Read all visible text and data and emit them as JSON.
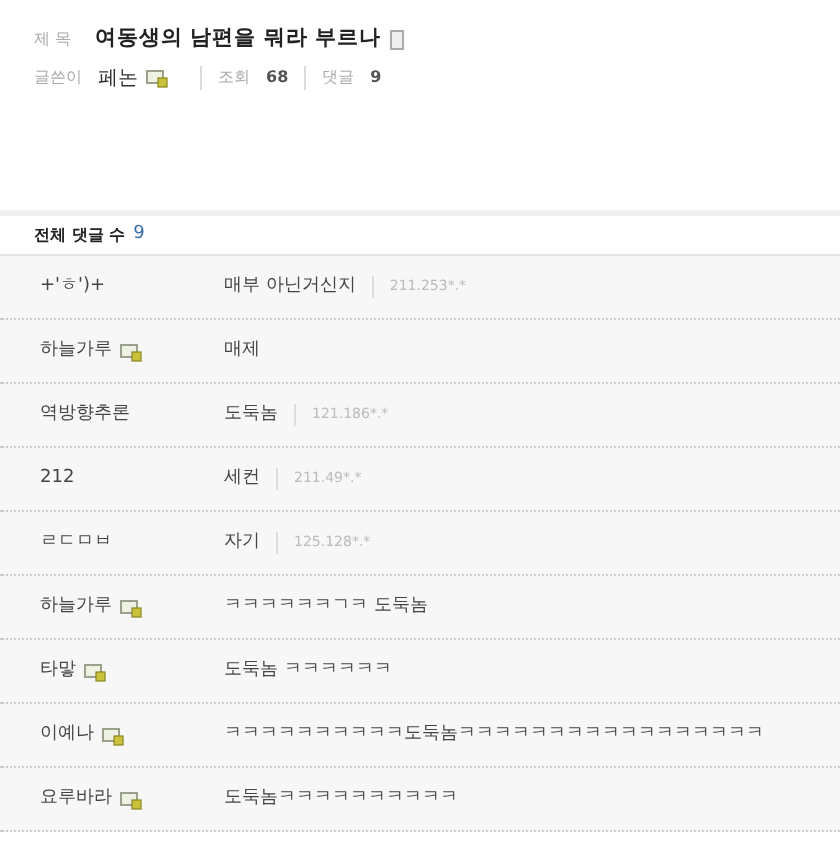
{
  "post": {
    "title_label": "제 목",
    "title": "여동생의 남편을 뭐라 부르나",
    "author_label": "글쓴이",
    "author": "페논",
    "author_member": true,
    "views_label": "조회",
    "views": "68",
    "replies_label": "댓글",
    "replies": "9"
  },
  "comments_header": {
    "label": "전체 댓글 수",
    "count": "9"
  },
  "comments": [
    {
      "author": "+'ㅎ')+",
      "member": false,
      "text": "매부 아닌거신지",
      "ip": "211.253*.*"
    },
    {
      "author": "하늘가루",
      "member": true,
      "text": "매제"
    },
    {
      "author": "역방향추론",
      "member": false,
      "text": "도둑놈",
      "ip": "121.186*.*"
    },
    {
      "author": "212",
      "member": false,
      "text": "세컨",
      "ip": "211.49*.*"
    },
    {
      "author": "ㄹㄷㅁㅂ",
      "member": false,
      "text": "자기",
      "ip": "125.128*.*"
    },
    {
      "author": "하늘가루",
      "member": true,
      "text": "ㅋㅋㅋㅋㅋㅋㄱㅋ 도둑놈"
    },
    {
      "author": "타맣",
      "member": true,
      "text": "도둑놈 ㅋㅋㅋㅋㅋㅋ"
    },
    {
      "author": "이예나",
      "member": true,
      "text": "ㅋㅋㅋㅋㅋㅋㅋㅋㅋㅋ도둑놈ㅋㅋㅋㅋㅋㅋㅋㅋㅋㅋㅋㅋㅋㅋㅋㅋㅋ"
    },
    {
      "author": "요루바라",
      "member": true,
      "text": "도둑놈ㅋㅋㅋㅋㅋㅋㅋㅋㅋㅋ"
    }
  ]
}
